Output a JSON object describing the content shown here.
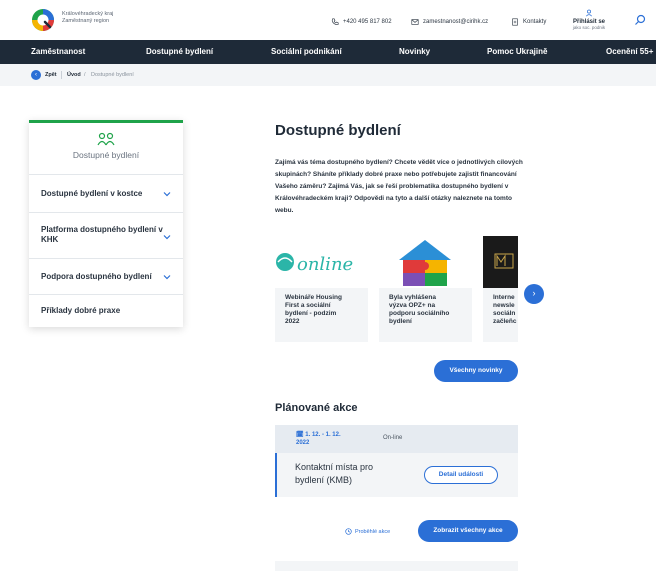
{
  "header": {
    "logo_line1": "Královéhradecký kraj",
    "logo_line2": "Zaměstnaný region",
    "phone": "+420 495 817 802",
    "email": "zamestnanost@cirihk.cz",
    "contacts": "Kontakty",
    "login_label": "Přihlásit se",
    "login_sub": "jako soc. podnik"
  },
  "nav": {
    "items": [
      "Zaměstnanost",
      "Dostupné bydlení",
      "Sociální podnikání",
      "Novinky",
      "Pomoc Ukrajině",
      "Ocenění 55+"
    ]
  },
  "breadcrumb": {
    "back": "Zpět",
    "home": "Úvod",
    "separator": "/",
    "current": "Dostupné bydlení"
  },
  "sidebar": {
    "title": "Dostupné bydlení",
    "items": [
      {
        "label": "Dostupné bydlení v kostce",
        "has_chevron": true
      },
      {
        "label": "Platforma dostupného bydlení v KHK",
        "has_chevron": true
      },
      {
        "label": "Podpora dostupného bydlení",
        "has_chevron": true
      },
      {
        "label": "Příklady dobré praxe",
        "has_chevron": false
      }
    ]
  },
  "main": {
    "title": "Dostupné bydlení",
    "intro": "Zajímá vás téma dostupného bydlení? Chcete vědět více o jednotlivých cílových skupinách? Sháníte příklady dobré praxe nebo potřebujete zajistit financování Vašeho záměru? Zajímá Vás, jak se řeší problematika dostupného bydlení v Královéhradeckém kraji? Odpovědi na tyto a další otázky naleznete na tomto webu.",
    "news": [
      {
        "text_lines": [
          "Webináře Housing",
          "First a sociální",
          "bydlení - podzim",
          "2022"
        ],
        "image_text": "online"
      },
      {
        "text_lines": [
          "Byla vyhlášena",
          "výzva OPZ+ na",
          "podporu sociálního",
          "bydlení"
        ]
      },
      {
        "text_lines": [
          "Interne",
          "newsle",
          "sociáln",
          "začleňc"
        ]
      }
    ],
    "all_news_button": "Všechny novinky"
  },
  "events": {
    "title": "Plánované akce",
    "items": [
      {
        "date_line1": "1. 12. - 1. 12.",
        "date_line2": "2022",
        "mode": "On-line",
        "title_line1": "Kontaktní místa pro",
        "title_line2": "bydlení (KMB)",
        "detail_button": "Detail události"
      }
    ],
    "past_link": "Proběhlé akce",
    "all_events_button": "Zobrazit všechny akce"
  },
  "colors": {
    "nav_bg": "#1e2a38",
    "accent_blue": "#2b6fd6",
    "accent_green": "#1fa34a",
    "panel_bg": "#f3f5f7"
  }
}
